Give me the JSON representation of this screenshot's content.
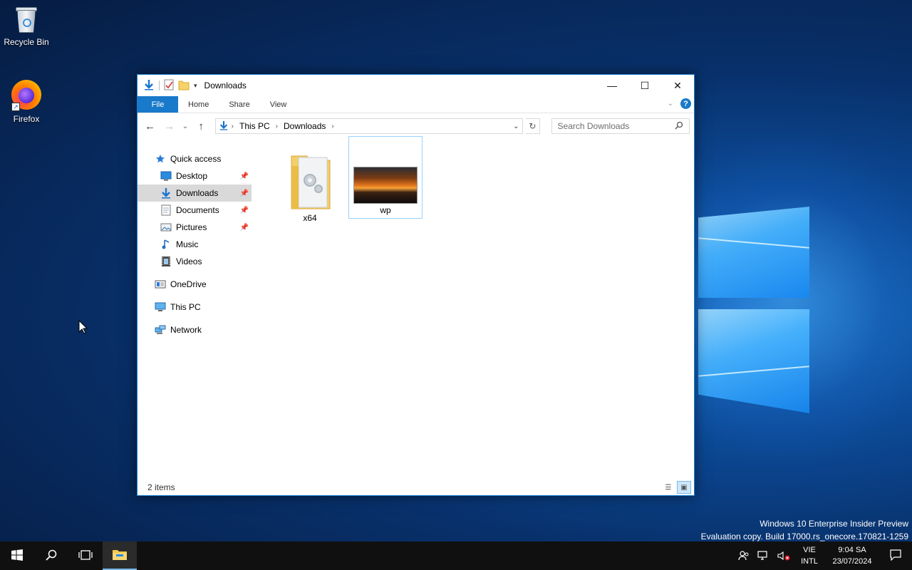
{
  "desktop": {
    "icons": [
      {
        "label": "Recycle Bin"
      },
      {
        "label": "Firefox"
      }
    ],
    "watermark": {
      "line1": "Windows 10 Enterprise Insider Preview",
      "line2": "Evaluation copy. Build 17000.rs_onecore.170821-1259"
    }
  },
  "explorer": {
    "title": "Downloads",
    "window_buttons": {
      "minimize": "—",
      "maximize": "☐",
      "close": "✕"
    },
    "ribbon_tabs": [
      {
        "label": "File",
        "active": true
      },
      {
        "label": "Home"
      },
      {
        "label": "Share"
      },
      {
        "label": "View"
      }
    ],
    "help_label": "?",
    "address": {
      "crumbs": [
        "This PC",
        "Downloads"
      ]
    },
    "search": {
      "placeholder": "Search Downloads"
    },
    "nav": {
      "quick_access": "Quick access",
      "items": [
        {
          "label": "Desktop",
          "pinned": true,
          "icon": "desktop-icon"
        },
        {
          "label": "Downloads",
          "pinned": true,
          "selected": true,
          "icon": "downloads-icon"
        },
        {
          "label": "Documents",
          "pinned": true,
          "icon": "documents-icon"
        },
        {
          "label": "Pictures",
          "pinned": true,
          "icon": "pictures-icon"
        },
        {
          "label": "Music",
          "icon": "music-icon"
        },
        {
          "label": "Videos",
          "icon": "videos-icon"
        }
      ],
      "onedrive": "OneDrive",
      "this_pc": "This PC",
      "network": "Network"
    },
    "files": [
      {
        "name": "x64",
        "type": "folder"
      },
      {
        "name": "wp",
        "type": "image",
        "selected": true
      }
    ],
    "status": "2 items"
  },
  "taskbar": {
    "language": {
      "line1": "VIE",
      "line2": "INTL"
    },
    "clock": {
      "time": "9:04 SA",
      "date": "23/07/2024"
    }
  },
  "colors": {
    "accent": "#1979ca",
    "selection_border": "#99d1ff",
    "taskbar": "#101010"
  }
}
